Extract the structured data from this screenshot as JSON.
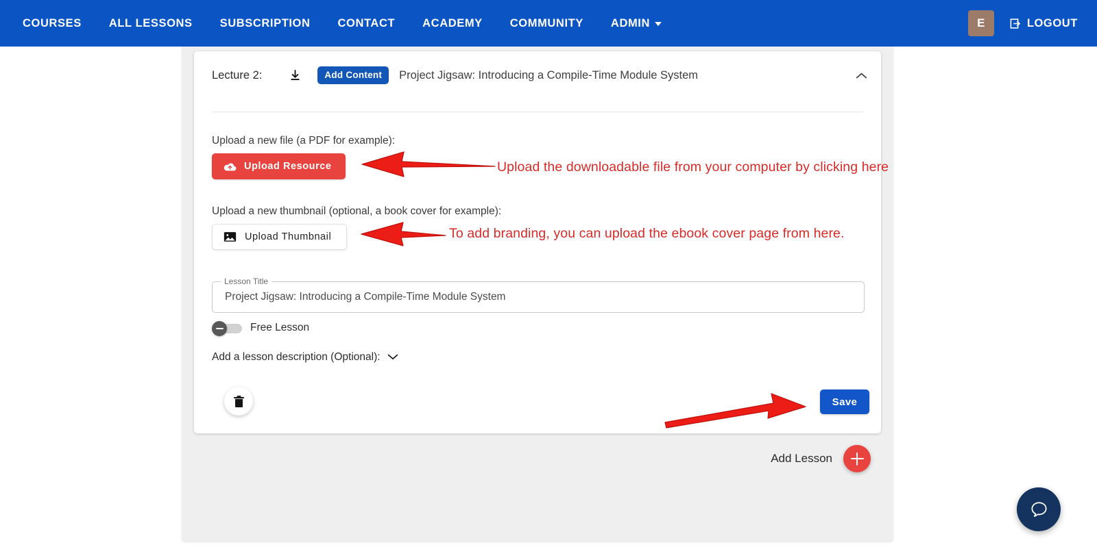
{
  "navbar": {
    "links": [
      {
        "label": "COURSES"
      },
      {
        "label": "ALL LESSONS"
      },
      {
        "label": "SUBSCRIPTION"
      },
      {
        "label": "CONTACT"
      },
      {
        "label": "ACADEMY"
      },
      {
        "label": "COMMUNITY"
      }
    ],
    "admin_label": "ADMIN",
    "avatar_initial": "E",
    "logout_label": "LOGOUT",
    "background_color": "#0b54c4",
    "avatar_color": "#9c7b68"
  },
  "lecture": {
    "number_label": "Lecture 2:",
    "download_icon": "download-icon",
    "add_content_label": "Add Content",
    "add_content_color": "#1256b8",
    "title": "Project Jigsaw: Introducing a Compile-Time Module System",
    "collapse_icon": "chevron-up-icon"
  },
  "form": {
    "file_label": "Upload a new file (a PDF for example):",
    "upload_resource_label": "Upload Resource",
    "upload_resource_icon": "cloud-upload-icon",
    "upload_resource_color": "#e8433e",
    "thumbnail_label": "Upload a new thumbnail (optional, a book cover for example):",
    "upload_thumbnail_label": "Upload Thumbnail",
    "upload_thumbnail_icon": "image-icon",
    "lesson_title_field_label": "Lesson Title",
    "lesson_title_value": "Project Jigsaw: Introducing a Compile-Time Module System",
    "free_lesson_label": "Free Lesson",
    "free_lesson_state": "off",
    "description_label": "Add a lesson description (Optional):",
    "description_chevron": "chevron-down-icon",
    "delete_icon": "trash-icon",
    "save_label": "Save",
    "save_color": "#1256c9"
  },
  "footer": {
    "add_lesson_label": "Add Lesson",
    "add_lesson_icon": "plus-icon",
    "add_lesson_color": "#e8433e"
  },
  "annotations": {
    "color": "#d92b28",
    "items": [
      {
        "text": "Upload the downloadable file from your computer by clicking here"
      },
      {
        "text": "To add branding, you can upload the ebook cover page from here."
      }
    ]
  },
  "help": {
    "icon": "chat-bubble-icon",
    "color": "#14335e"
  }
}
